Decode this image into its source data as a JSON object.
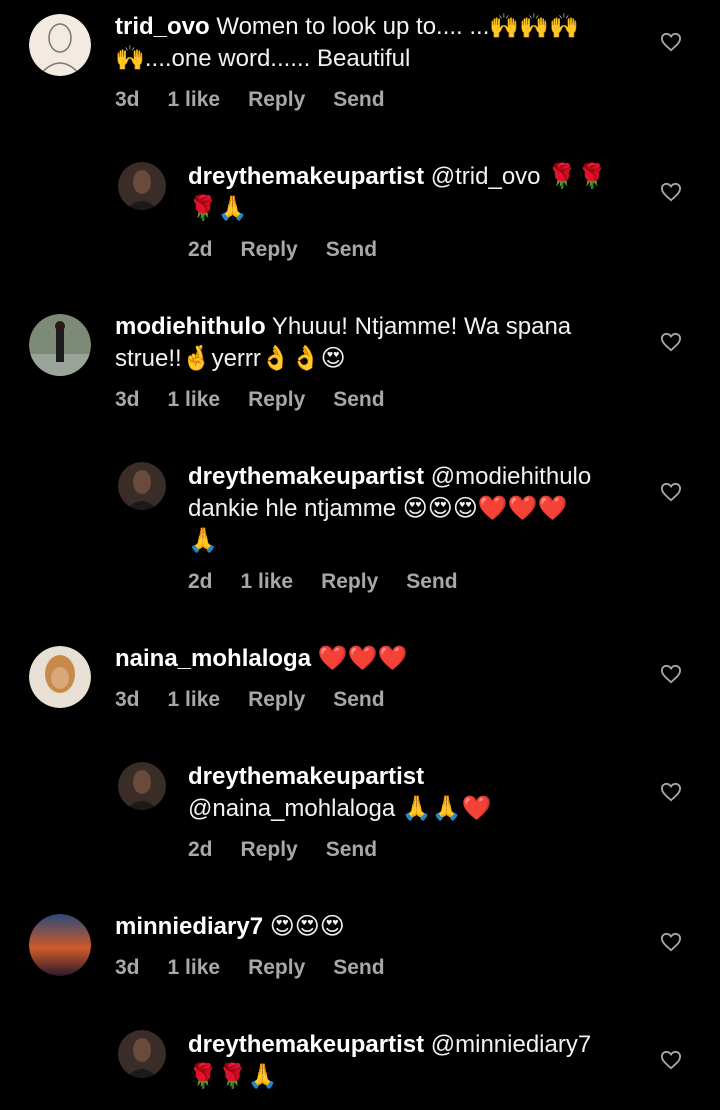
{
  "comments": [
    {
      "user": "trid_ovo",
      "text": " Women to look up to.... ...🙌🙌🙌\n🙌....one word...... Beautiful",
      "time": "3d",
      "likes": "1 like",
      "reply": "Reply",
      "send": "Send",
      "replies": [
        {
          "user": "dreythemakeupartist",
          "text": " @trid_ovo 🌹🌹\n🌹🙏",
          "time": "2d",
          "likes": "",
          "reply": "Reply",
          "send": "Send"
        }
      ]
    },
    {
      "user": "modiehithulo",
      "text": " Yhuuu! Ntjamme! Wa spana\nstrue!!🤞yerrr👌👌😍",
      "time": "3d",
      "likes": "1 like",
      "reply": "Reply",
      "send": "Send",
      "replies": [
        {
          "user": "dreythemakeupartist",
          "text": " @modiehithulo\ndankie hle ntjamme 😍😍😍❤️❤️❤️\n🙏",
          "time": "2d",
          "likes": "1 like",
          "reply": "Reply",
          "send": "Send"
        }
      ]
    },
    {
      "user": "naina_mohlaloga",
      "text": " ❤️❤️❤️",
      "time": "3d",
      "likes": "1 like",
      "reply": "Reply",
      "send": "Send",
      "replies": [
        {
          "user": "dreythemakeupartist",
          "text": "\n@naina_mohlaloga 🙏🙏❤️",
          "time": "2d",
          "likes": "",
          "reply": "Reply",
          "send": "Send"
        }
      ]
    },
    {
      "user": "minniediary7",
      "text": " 😍😍😍",
      "time": "3d",
      "likes": "1 like",
      "reply": "Reply",
      "send": "Send",
      "replies": [
        {
          "user": "dreythemakeupartist",
          "text": " @minniediary7\n🌹🌹🙏",
          "time": "",
          "likes": "",
          "reply": "",
          "send": ""
        }
      ]
    }
  ],
  "colors": {
    "background": "#000000",
    "meta": "#a8a8a8",
    "text": "#f2f2f2"
  },
  "icons": {
    "like": "heart-outline-icon"
  }
}
